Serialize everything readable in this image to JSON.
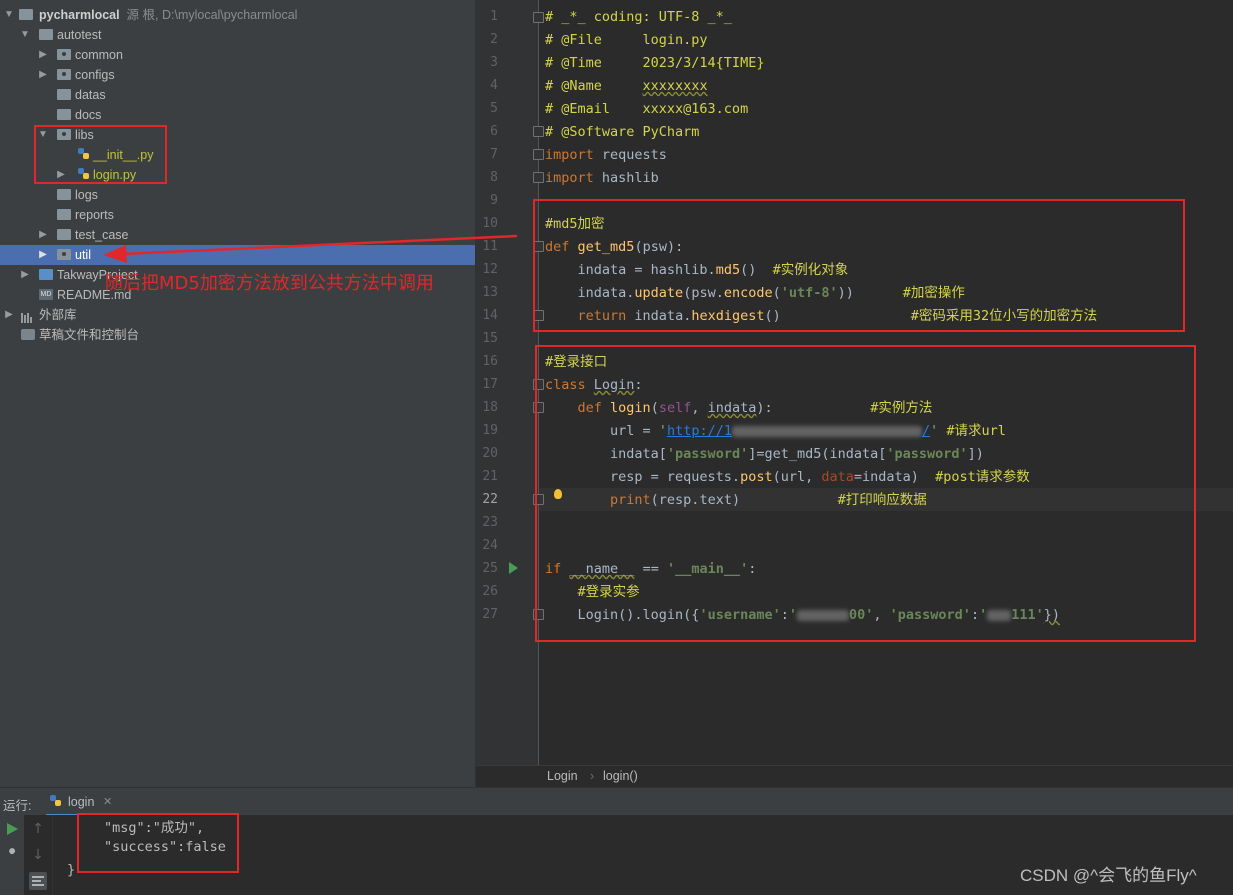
{
  "project": {
    "root_name": "pycharmlocal",
    "root_hint": "源 根, D:\\mylocal\\pycharmlocal",
    "items": [
      {
        "label": "autotest"
      },
      {
        "label": "common"
      },
      {
        "label": "configs"
      },
      {
        "label": "datas"
      },
      {
        "label": "docs"
      },
      {
        "label": "libs"
      },
      {
        "label": "__init__.py"
      },
      {
        "label": "login.py"
      },
      {
        "label": "logs"
      },
      {
        "label": "reports"
      },
      {
        "label": "test_case"
      },
      {
        "label": "util"
      },
      {
        "label": "TakwayProject"
      },
      {
        "label": "README.md"
      },
      {
        "label": "外部库"
      },
      {
        "label": "草稿文件和控制台"
      }
    ],
    "selected": "util"
  },
  "annotation": {
    "text": "随后把MD5加密方法放到公共方法中调用"
  },
  "editor": {
    "line_numbers": [
      "1",
      "2",
      "3",
      "4",
      "5",
      "6",
      "7",
      "8",
      "9",
      "10",
      "11",
      "12",
      "13",
      "14",
      "15",
      "16",
      "17",
      "18",
      "19",
      "20",
      "21",
      "22",
      "23",
      "24",
      "25",
      "26",
      "27"
    ],
    "current_line": "22",
    "header": {
      "l1": "# _*_ coding: UTF-8 _*_",
      "l2": "# @File     login.py",
      "l3": "# @Time     2023/3/14{TIME}",
      "l4_prefix": "# @Name     ",
      "l4_name": "xxxxxxxx",
      "l5": "# @Email    xxxxx@163.com",
      "l6": "# @Software PyCharm"
    },
    "imports": {
      "kw": "import",
      "mod1": " requests",
      "mod2": " hashlib"
    },
    "md5_block": {
      "comment": "#md5加密",
      "def_kw": "def",
      "fname": "get_md5",
      "param": "psw",
      "l12_a": "    indata = hashlib.",
      "l12_fn": "md5",
      "l12_b": "()  ",
      "l12_cm": "#实例化对象",
      "l13_a": "    indata.",
      "l13_fn": "update",
      "l13_b": "(psw.",
      "l13_fn2": "encode",
      "l13_c": "(",
      "l13_str": "'utf-8'",
      "l13_d": "))      ",
      "l13_cm": "#加密操作",
      "l14_kw": "return",
      "l14_a": " indata.",
      "l14_fn": "hexdigest",
      "l14_b": "()                ",
      "l14_cm": "#密码采用32位小写的加密方法"
    },
    "class_block": {
      "comment": "#登录接口",
      "class_kw": "class",
      "class_name": "Login",
      "l18_kw": "def",
      "l18_fn": "login",
      "l18_self": "self",
      "l18_param": "indata",
      "l18_cm": "#实例方法",
      "l19_a": "        url = ",
      "l19_q1": "'",
      "l19_url": "http://1",
      "l19_url_end": "/",
      "l19_q2": "'",
      "l19_cm": " #请求url",
      "l20_a": "        indata[",
      "l20_str": "'password'",
      "l20_b": "]=get_md5(indata[",
      "l20_str2": "'password'",
      "l20_c": "])",
      "l21_a": "        resp = requests.",
      "l21_fn": "post",
      "l21_b": "(url, ",
      "l21_kwarg": "data",
      "l21_c": "=indata)  ",
      "l21_cm": "#post请求参数",
      "l22_fn": "print",
      "l22_a": "(resp.text)",
      "l22_cm": "#打印响应数据"
    },
    "main_block": {
      "if_kw": "if",
      "name_var": "__name__",
      "eq": " == ",
      "main_str": "'__main__'",
      "colon": ":",
      "comment": "#登录实参",
      "l27_a": "    Login().login({",
      "l27_k1": "'username'",
      "l27_colon1": ":",
      "l27_v1": "'",
      "l27_v1_end": "00'",
      "l27_sep": ", ",
      "l27_k2": "'password'",
      "l27_colon2": ":",
      "l27_v2": "'",
      "l27_v2_end": "111'",
      "l27_end": "})"
    }
  },
  "breadcrumbs": [
    "Login",
    "login()"
  ],
  "run": {
    "title": "运行:",
    "tab": "login",
    "output": [
      "\"msg\":\"成功\",",
      "\"success\":false",
      "}"
    ]
  },
  "watermark": "CSDN @^会飞的鱼Fly^",
  "colors": {
    "annotation_red": "#e0282a",
    "selection_blue": "#4b6eaf",
    "comment_yellow": "#d4d44a",
    "keyword_orange": "#cc7832"
  }
}
